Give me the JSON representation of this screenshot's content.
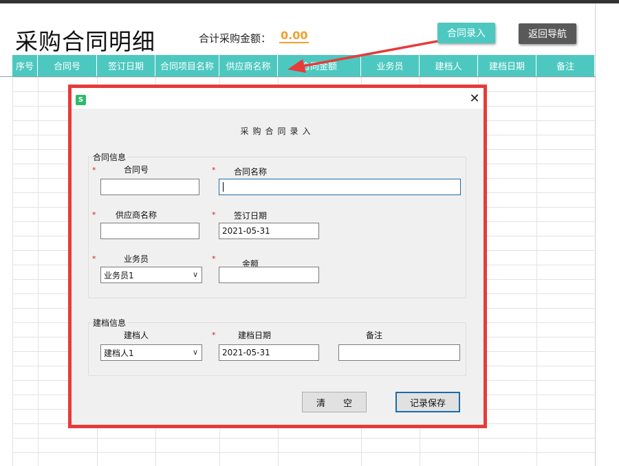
{
  "page": {
    "title": "采购合同明细",
    "total_label": "合计采购金额：",
    "total_value": "0.00",
    "entry_button": "合同录入",
    "back_button": "返回导航"
  },
  "table": {
    "columns": [
      "序号",
      "合同号",
      "签订日期",
      "合同项目名称",
      "供应商名称",
      "合同金额",
      "业务员",
      "建档人",
      "建档日期",
      "备注"
    ]
  },
  "dialog": {
    "heading": "采购合同录入",
    "app_icon": "S",
    "contract_group": "合同信息",
    "archive_group": "建档信息",
    "required_mark": "*",
    "fields": {
      "contract_no_label": "合同号",
      "contract_no_value": "",
      "contract_name_label": "合同名称",
      "contract_name_value": "",
      "supplier_label": "供应商名称",
      "supplier_value": "",
      "sign_date_label": "签订日期",
      "sign_date_value": "2021-05-31",
      "salesman_label": "业务员",
      "salesman_value": "业务员1",
      "amount_label": "金额",
      "amount_value": "",
      "creator_label": "建档人",
      "creator_value": "建档人1",
      "create_date_label": "建档日期",
      "create_date_value": "2021-05-31",
      "remark_label": "备注",
      "remark_value": ""
    },
    "clear_button": "清　　空",
    "save_button": "记录保存"
  },
  "colors": {
    "accent": "#4dc8c0",
    "back_button": "#595959",
    "total": "#f0a030",
    "highlight": "#e83a3a"
  }
}
